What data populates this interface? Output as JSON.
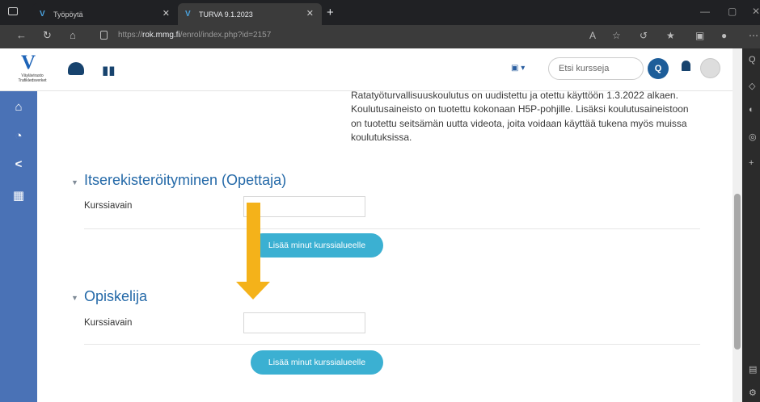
{
  "browser": {
    "tabs": [
      {
        "title": "Työpöytä",
        "active": false
      },
      {
        "title": "TURVA 9.1.2023",
        "active": true
      }
    ],
    "url_prefix": "https://",
    "url_domain": "rok.mmg.fi",
    "url_path": "/enrol/index.php?id=2157"
  },
  "navbar": {
    "logo_letter": "V",
    "logo_line1": "Väylävirasto",
    "logo_line2": "Trafikledsverket",
    "search_placeholder": "Etsi kursseja"
  },
  "course_description": "Ratatyöturvallisuuskoulutus on uudistettu ja otettu käyttöön 1.3.2022 alkaen. Koulutusaineisto on tuotettu kokonaan H5P-pohjille. Lisäksi koulutusaineistoon on tuotettu seitsämän uutta videota, joita voidaan käyttää tukena myös muissa koulutuksissa.",
  "enrol_sections": [
    {
      "title": "Itserekisteröityminen (Opettaja)",
      "field_label": "Kurssiavain",
      "field_value": "",
      "button_label": "Lisää minut kurssialueelle"
    },
    {
      "title": "Opiskelija",
      "field_label": "Kurssiavain",
      "field_value": "",
      "button_label": "Lisää minut kurssialueelle"
    }
  ],
  "colors": {
    "accent": "#3bb0d2",
    "section_title": "#2469a8",
    "drawer": "#4a72b6",
    "annotation_arrow": "#f4b21a"
  }
}
